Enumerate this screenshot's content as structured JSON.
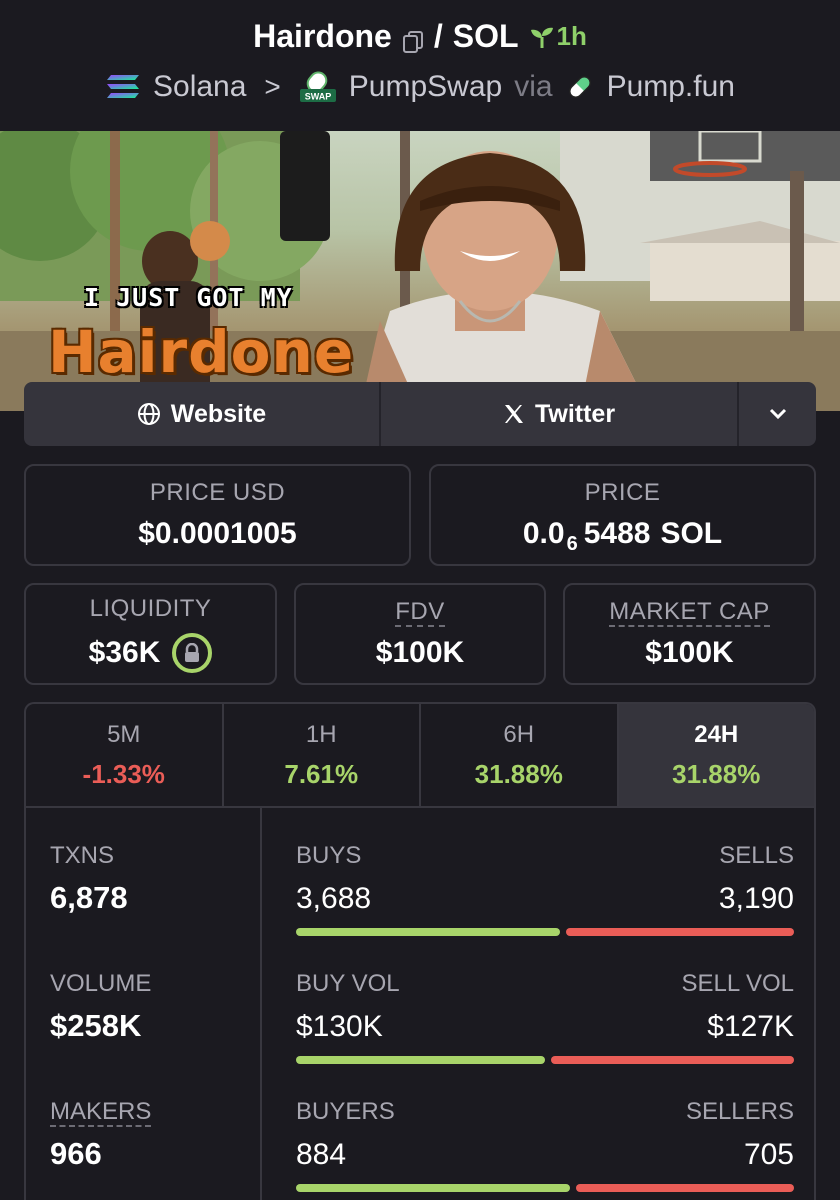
{
  "header": {
    "token": "Hairdone",
    "quote": "SOL",
    "separator": "/",
    "age": "1h",
    "chain": "Solana",
    "dex": "PumpSwap",
    "via": "via",
    "launchpad": "Pump.fun",
    "dex_icon_text": "SWAP"
  },
  "banner": {
    "caption_top": "I JUST GOT MY",
    "caption_main": "Hairdone"
  },
  "links": {
    "website": "Website",
    "twitter": "Twitter"
  },
  "price": {
    "usd_label": "PRICE USD",
    "usd_value": "$0.0001005",
    "native_label": "PRICE",
    "native_prefix": "0.0",
    "native_zeros": "6",
    "native_digits": "5488",
    "native_unit": "SOL"
  },
  "metrics": {
    "liquidity_label": "LIQUIDITY",
    "liquidity_value": "$36K",
    "fdv_label": "FDV",
    "fdv_value": "$100K",
    "mcap_label": "MARKET CAP",
    "mcap_value": "$100K"
  },
  "timeframes": [
    {
      "label": "5M",
      "change": "-1.33%"
    },
    {
      "label": "1H",
      "change": "7.61%"
    },
    {
      "label": "6H",
      "change": "31.88%"
    },
    {
      "label": "24H",
      "change": "31.88%"
    }
  ],
  "stats": {
    "txns_label": "TXNS",
    "txns_value": "6,878",
    "volume_label": "VOLUME",
    "volume_value": "$258K",
    "makers_label": "MAKERS",
    "makers_value": "966",
    "buys_label": "BUYS",
    "buys_value": "3,688",
    "sells_label": "SELLS",
    "sells_value": "3,190",
    "buys_fraction": 0.536,
    "buy_vol_label": "BUY VOL",
    "buy_vol_value": "$130K",
    "sell_vol_label": "SELL VOL",
    "sell_vol_value": "$127K",
    "buy_vol_fraction": 0.506,
    "buyers_label": "BUYERS",
    "buyers_value": "884",
    "sellers_label": "SELLERS",
    "sellers_value": "705",
    "buyers_fraction": 0.556
  },
  "colors": {
    "positive": "#a8d46a",
    "negative": "#ea5d57",
    "background": "#1b1a20",
    "panel": "#35343c"
  }
}
